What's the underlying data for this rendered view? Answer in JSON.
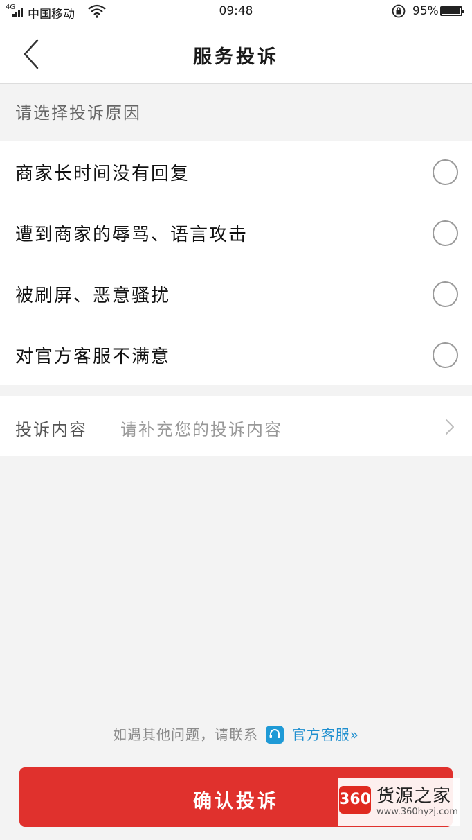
{
  "status_bar": {
    "network": "4G",
    "carrier": "中国移动",
    "time": "09:48",
    "battery": "95%",
    "battery_level": 0.95
  },
  "nav": {
    "title": "服务投诉"
  },
  "section_title": "请选择投诉原因",
  "reasons": [
    {
      "label": "商家长时间没有回复"
    },
    {
      "label": "遭到商家的辱骂、语言攻击"
    },
    {
      "label": "被刷屏、恶意骚扰"
    },
    {
      "label": "对官方客服不满意"
    }
  ],
  "content_row": {
    "label": "投诉内容",
    "placeholder": "请补充您的投诉内容"
  },
  "contact": {
    "prefix": "如遇其他问题，请联系",
    "link": "官方客服",
    "arrow": "»"
  },
  "confirm_button": "确认投诉",
  "watermark": {
    "logo": "360",
    "name": "货源之家",
    "url": "www.360hyzj.com"
  },
  "colors": {
    "accent": "#e0312d",
    "link": "#1f8fcf"
  }
}
